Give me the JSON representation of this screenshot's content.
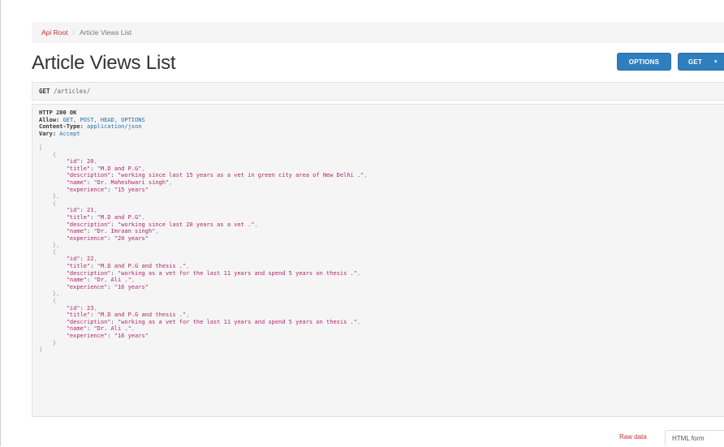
{
  "breadcrumb": {
    "root": "Api Root",
    "separator": "/",
    "current": "Article Views List"
  },
  "page_title": "Article Views List",
  "buttons": {
    "options": "OPTIONS",
    "get": "GET",
    "get_caret": "▾"
  },
  "request": {
    "method": "GET",
    "path": "/articles/"
  },
  "response": {
    "status": "HTTP 200 OK",
    "headers": [
      {
        "key": "Allow:",
        "value": "GET, POST, HEAD, OPTIONS"
      },
      {
        "key": "Content-Type:",
        "value": "application/json"
      },
      {
        "key": "Vary:",
        "value": "Accept"
      }
    ],
    "items": [
      {
        "id": "20",
        "title": "\"M.D and P.G\"",
        "description": "\"working since last 15 years as a vet in green city area of New Delhi .\"",
        "name": "\"Dr. Maheshwari singh\"",
        "experience": "\"15 years\""
      },
      {
        "id": "21",
        "title": "\"M.D and P.G\"",
        "description": "\"working since last 20 years as a vet .\"",
        "name": "\"Dr. Imraan singh\"",
        "experience": "\"20 years\""
      },
      {
        "id": "22",
        "title": "\"M.D and P.G and thesis .\"",
        "description": "\"working as a vet for the last 11 years and spend 5 years on thesis .\"",
        "name": "\"Dr. Ali .\"",
        "experience": "\"16 years\""
      },
      {
        "id": "23",
        "title": "\"M.D and P.G and thesis .\"",
        "description": "\"working as a vet for the last 11 years and spend 5 years on thesis .\"",
        "name": "\"Dr. Ali .\"",
        "experience": "\"16 years\""
      }
    ]
  },
  "footer": {
    "raw_data": "Raw data",
    "html_form": "HTML form"
  },
  "colors": {
    "primary_button": "#2f7fbf",
    "link": "#c9302c",
    "json_string": "#b0266c",
    "header_value": "#1f6fa8"
  }
}
